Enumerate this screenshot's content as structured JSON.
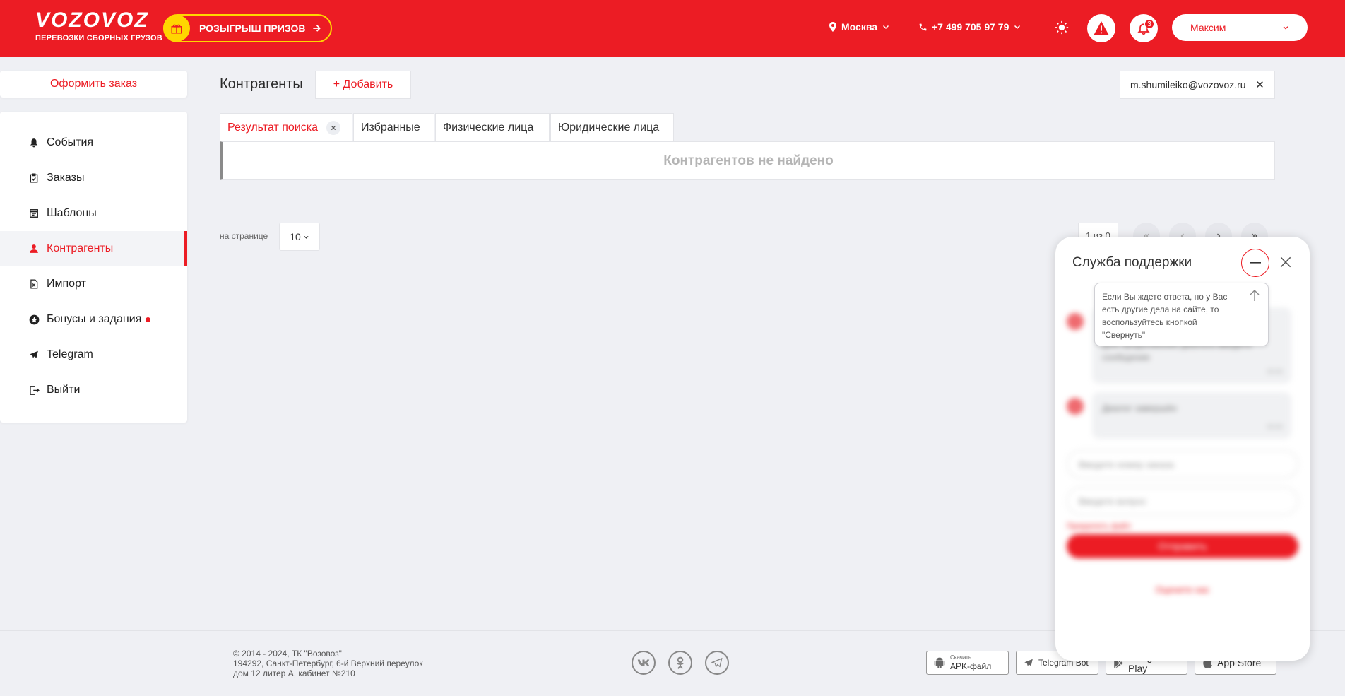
{
  "header": {
    "logo_text": "VOZOVOZ",
    "logo_subtitle": "ПЕРЕВОЗКИ СБОРНЫХ ГРУЗОВ",
    "promo_label": "РОЗЫГРЫШ ПРИЗОВ",
    "city": "Москва",
    "phone": "+7 499 705 97 79",
    "notifications_count": "3",
    "user_name": "Максим",
    "brand_color": "#ec1c24",
    "promo_color": "#ffd600"
  },
  "sidebar": {
    "order_button": "Оформить заказ",
    "items": [
      {
        "label": "События",
        "icon": "bell-icon"
      },
      {
        "label": "Заказы",
        "icon": "clipboard-icon"
      },
      {
        "label": "Шаблоны",
        "icon": "template-icon"
      },
      {
        "label": "Контрагенты",
        "icon": "person-icon",
        "active": true
      },
      {
        "label": "Импорт",
        "icon": "excel-icon"
      },
      {
        "label": "Бонусы и задания",
        "icon": "star-icon"
      },
      {
        "label": "Telegram",
        "icon": "telegram-icon"
      },
      {
        "label": "Выйти",
        "icon": "logout-icon"
      }
    ]
  },
  "main": {
    "title": "Контрагенты",
    "add_button": "+ Добавить",
    "search_value": "m.shumileiko@vozovoz.ru",
    "tabs": [
      {
        "label": "Результат поиска",
        "active": true
      },
      {
        "label": "Избранные"
      },
      {
        "label": "Физические лица"
      },
      {
        "label": "Юридические лица"
      }
    ],
    "empty_message": "Контрагентов не найдено",
    "per_page_label": "на странице",
    "per_page_value": "10",
    "pager_count": "1 из 0"
  },
  "footer": {
    "copyright_line1": "© 2014 - 2024, ТК \"Возовоз\"",
    "copyright_line2": "194292, Санкт-Петербург, 6-й Верхний переулок",
    "copyright_line3": "дом 12 литер А, кабинет №210",
    "apk_small": "Скачать",
    "apk_label": "APK-файл",
    "telegram_bot": "Telegram Bot",
    "google_play": "Google Play",
    "app_store": "App Store"
  },
  "support": {
    "title": "Служба поддержки",
    "tooltip": "Если Вы ждете ответа, но у Вас есть другие дела на сайте, то воспользуйтесь кнопкой \"Свернуть\"",
    "blurred_message_1": "Для продолжения диалога введите сообщение",
    "blurred_message_2": "Диалог завершён",
    "blurred_input_1": "Введите номер заказа",
    "blurred_input_2": "Введите вопрос",
    "blurred_link": "Прикрепить файл",
    "send_button": "Отправить",
    "rate_text": "Оцените нас"
  }
}
